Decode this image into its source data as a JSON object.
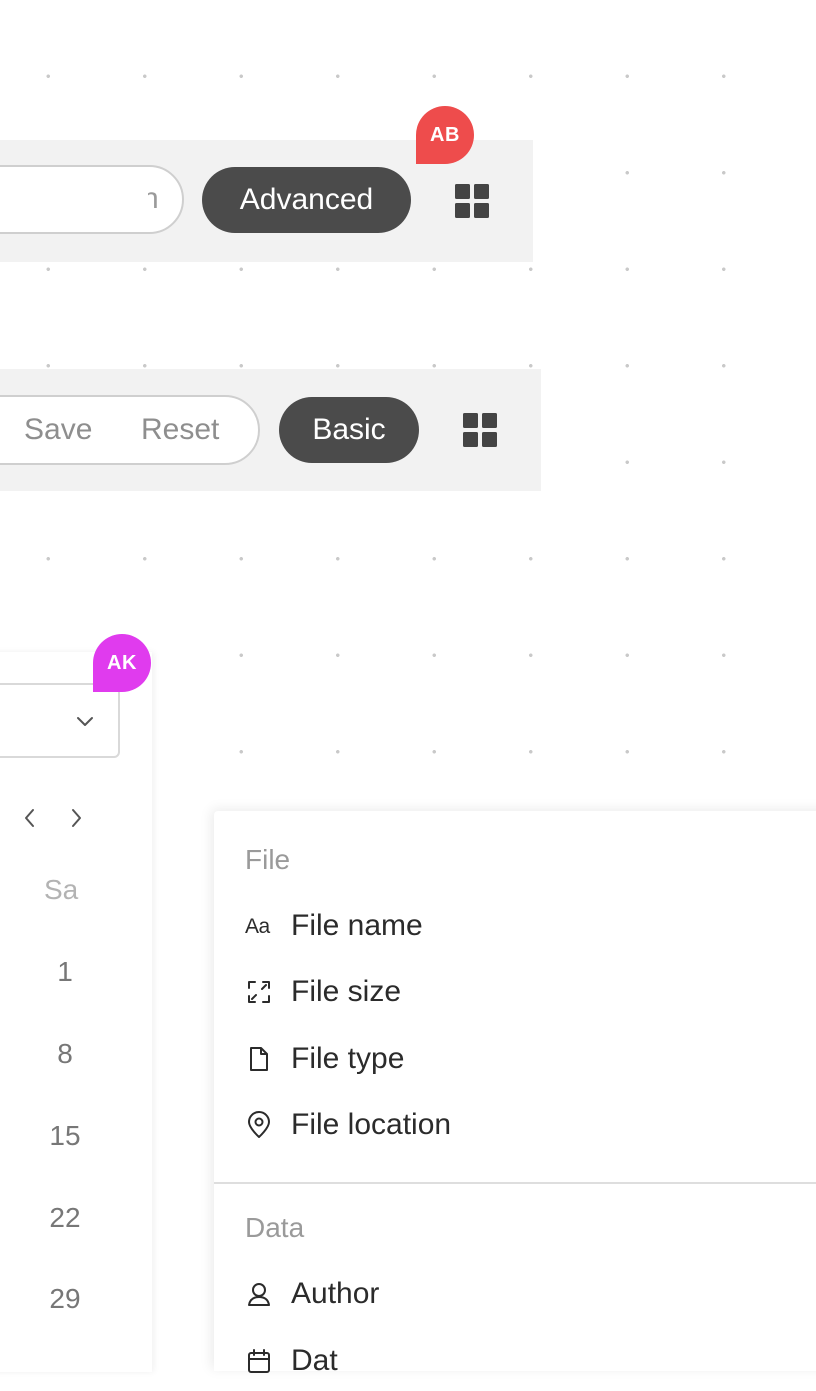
{
  "toolbar_advanced": {
    "search_tail": "n",
    "mode_label": "Advanced",
    "avatar_initials": "AB",
    "grid_icon": "grid-icon"
  },
  "toolbar_basic": {
    "save_label": "Save",
    "reset_label": "Reset",
    "mode_label": "Basic",
    "grid_icon": "grid-icon"
  },
  "calendar": {
    "avatar_initials": "AK",
    "weekday": "Sa",
    "days": [
      "1",
      "8",
      "15",
      "22",
      "29"
    ],
    "icons": {
      "select": "chevron-down-icon",
      "prev": "chevron-left-icon",
      "next": "chevron-right-icon"
    }
  },
  "menu": {
    "sections": [
      {
        "heading": "File",
        "items": [
          {
            "label": "File name",
            "icon": "text-format-icon"
          },
          {
            "label": "File size",
            "icon": "expand-icon"
          },
          {
            "label": "File type",
            "icon": "document-icon"
          },
          {
            "label": "File location",
            "icon": "location-pin-icon"
          }
        ]
      },
      {
        "heading": "Data",
        "items": [
          {
            "label": "Author",
            "icon": "person-icon"
          },
          {
            "label": "Dat",
            "icon": "calendar-icon"
          }
        ]
      }
    ]
  },
  "colors": {
    "avatar_ab": "#ee4c4c",
    "avatar_ak": "#e03bee",
    "mode_button": "#4b4b4b",
    "toolbar_bg": "#f2f2f2"
  }
}
